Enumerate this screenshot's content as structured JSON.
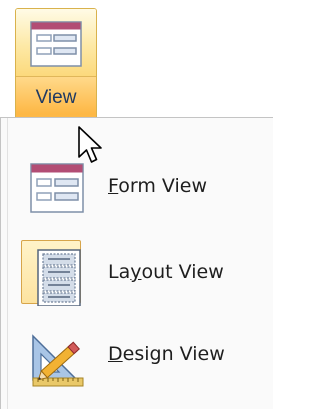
{
  "ribbon": {
    "view_button": {
      "label": "View",
      "icon": "form-view-icon"
    }
  },
  "menu": {
    "items": [
      {
        "icon": "form-view-icon",
        "access_key": "F",
        "rest": "orm View"
      },
      {
        "icon": "layout-view-icon",
        "before_key": "La",
        "access_key": "y",
        "rest": "out View",
        "highlighted": true
      },
      {
        "icon": "design-view-icon",
        "access_key": "D",
        "rest": "esign View"
      }
    ]
  },
  "cursor": {
    "icon": "arrow-pointer-icon"
  },
  "colors": {
    "button_hover_top": "#fde9a6",
    "button_hover_bottom": "#fdb744",
    "button_border": "#d9b24c",
    "form_header": "#b24d74",
    "text": "#1e1e1e",
    "label_blue": "#1e3963"
  }
}
